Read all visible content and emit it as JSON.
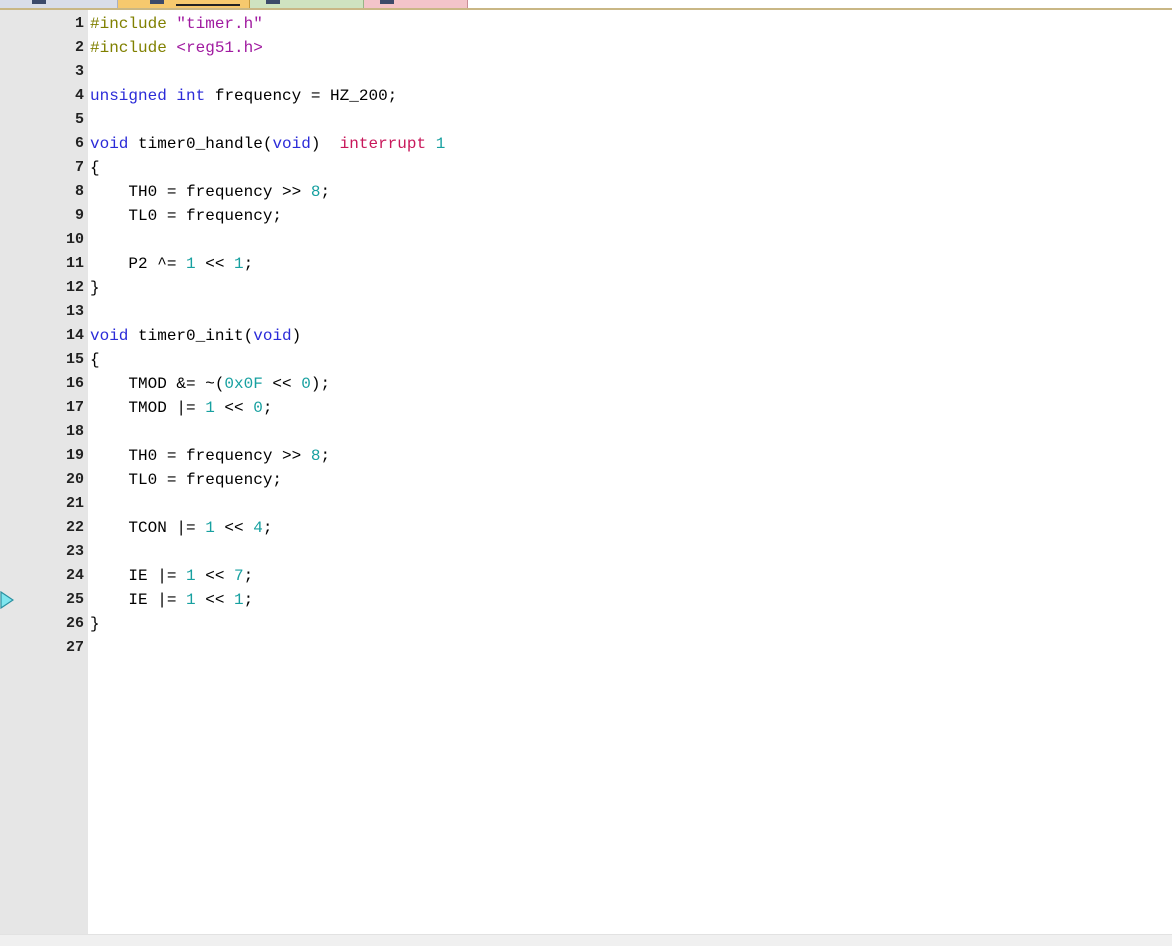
{
  "colors": {
    "gutter": "#e6e6e6",
    "preprocessor": "#808000",
    "string": "#a01aa0",
    "keyword": "#2b2bd8",
    "number": "#17a0a0",
    "c51_keyword": "#c8175a",
    "exec_arrow_fill": "#7fe6ee",
    "exec_arrow_stroke": "#2a8fa0"
  },
  "editor": {
    "current_line": 25,
    "lines": [
      {
        "n": "1",
        "tokens": [
          {
            "t": "pp",
            "v": "#include "
          },
          {
            "t": "str",
            "v": "\"timer.h\""
          }
        ]
      },
      {
        "n": "2",
        "tokens": [
          {
            "t": "pp",
            "v": "#include "
          },
          {
            "t": "str",
            "v": "<reg51.h>"
          }
        ]
      },
      {
        "n": "3",
        "tokens": []
      },
      {
        "n": "4",
        "tokens": [
          {
            "t": "kw",
            "v": "unsigned"
          },
          {
            "t": "id",
            "v": " "
          },
          {
            "t": "kw",
            "v": "int"
          },
          {
            "t": "id",
            "v": " frequency = HZ_200;"
          }
        ]
      },
      {
        "n": "5",
        "tokens": []
      },
      {
        "n": "6",
        "tokens": [
          {
            "t": "kw",
            "v": "void"
          },
          {
            "t": "id",
            "v": " timer0_handle("
          },
          {
            "t": "kw",
            "v": "void"
          },
          {
            "t": "id",
            "v": ")  "
          },
          {
            "t": "ck",
            "v": "interrupt"
          },
          {
            "t": "id",
            "v": " "
          },
          {
            "t": "num",
            "v": "1"
          }
        ]
      },
      {
        "n": "7",
        "tokens": [
          {
            "t": "id",
            "v": "{"
          }
        ]
      },
      {
        "n": "8",
        "tokens": [
          {
            "t": "id",
            "v": "    TH0 = frequency >> "
          },
          {
            "t": "num",
            "v": "8"
          },
          {
            "t": "id",
            "v": ";"
          }
        ]
      },
      {
        "n": "9",
        "tokens": [
          {
            "t": "id",
            "v": "    TL0 = frequency;"
          }
        ]
      },
      {
        "n": "10",
        "tokens": []
      },
      {
        "n": "11",
        "tokens": [
          {
            "t": "id",
            "v": "    P2 ^= "
          },
          {
            "t": "num",
            "v": "1"
          },
          {
            "t": "id",
            "v": " << "
          },
          {
            "t": "num",
            "v": "1"
          },
          {
            "t": "id",
            "v": ";"
          }
        ]
      },
      {
        "n": "12",
        "tokens": [
          {
            "t": "id",
            "v": "}"
          }
        ]
      },
      {
        "n": "13",
        "tokens": []
      },
      {
        "n": "14",
        "tokens": [
          {
            "t": "kw",
            "v": "void"
          },
          {
            "t": "id",
            "v": " timer0_init("
          },
          {
            "t": "kw",
            "v": "void"
          },
          {
            "t": "id",
            "v": ")"
          }
        ]
      },
      {
        "n": "15",
        "tokens": [
          {
            "t": "id",
            "v": "{"
          }
        ]
      },
      {
        "n": "16",
        "tokens": [
          {
            "t": "id",
            "v": "    TMOD &= ~("
          },
          {
            "t": "num",
            "v": "0x0F"
          },
          {
            "t": "id",
            "v": " << "
          },
          {
            "t": "num",
            "v": "0"
          },
          {
            "t": "id",
            "v": ");"
          }
        ]
      },
      {
        "n": "17",
        "tokens": [
          {
            "t": "id",
            "v": "    TMOD |= "
          },
          {
            "t": "num",
            "v": "1"
          },
          {
            "t": "id",
            "v": " << "
          },
          {
            "t": "num",
            "v": "0"
          },
          {
            "t": "id",
            "v": ";"
          }
        ]
      },
      {
        "n": "18",
        "tokens": []
      },
      {
        "n": "19",
        "tokens": [
          {
            "t": "id",
            "v": "    TH0 = frequency >> "
          },
          {
            "t": "num",
            "v": "8"
          },
          {
            "t": "id",
            "v": ";"
          }
        ]
      },
      {
        "n": "20",
        "tokens": [
          {
            "t": "id",
            "v": "    TL0 = frequency;"
          }
        ]
      },
      {
        "n": "21",
        "tokens": []
      },
      {
        "n": "22",
        "tokens": [
          {
            "t": "id",
            "v": "    TCON |= "
          },
          {
            "t": "num",
            "v": "1"
          },
          {
            "t": "id",
            "v": " << "
          },
          {
            "t": "num",
            "v": "4"
          },
          {
            "t": "id",
            "v": ";"
          }
        ]
      },
      {
        "n": "23",
        "tokens": []
      },
      {
        "n": "24",
        "tokens": [
          {
            "t": "id",
            "v": "    IE |= "
          },
          {
            "t": "num",
            "v": "1"
          },
          {
            "t": "id",
            "v": " << "
          },
          {
            "t": "num",
            "v": "7"
          },
          {
            "t": "id",
            "v": ";"
          }
        ]
      },
      {
        "n": "25",
        "tokens": [
          {
            "t": "id",
            "v": "    IE |= "
          },
          {
            "t": "num",
            "v": "1"
          },
          {
            "t": "id",
            "v": " << "
          },
          {
            "t": "num",
            "v": "1"
          },
          {
            "t": "id",
            "v": ";"
          }
        ]
      },
      {
        "n": "26",
        "tokens": [
          {
            "t": "id",
            "v": "}"
          }
        ]
      },
      {
        "n": "27",
        "tokens": []
      }
    ]
  }
}
